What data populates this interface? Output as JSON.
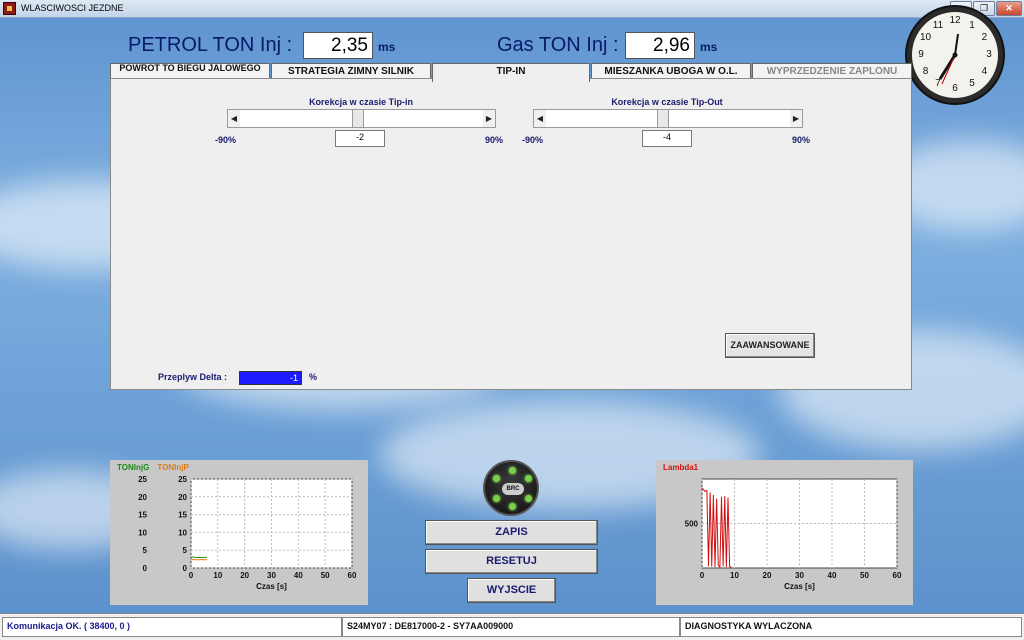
{
  "window": {
    "title": "WLASCIWOSCI JEZDNE",
    "min_glyph": "—",
    "max_glyph": "❐",
    "close_glyph": "✕"
  },
  "header": {
    "petrol_label": "PETROL TON Inj :",
    "petrol_value": "2,35",
    "gas_label": "Gas TON Inj :",
    "gas_value": "2,96",
    "unit": "ms"
  },
  "clock": {
    "numbers": [
      "12",
      "1",
      "2",
      "3",
      "4",
      "5",
      "6",
      "7",
      "8",
      "9",
      "10",
      "11"
    ]
  },
  "tabs": [
    {
      "label": "POWROT TO BIEGU JALOWEGO",
      "active": false
    },
    {
      "label": "STRATEGIA ZIMNY SILNIK",
      "active": false
    },
    {
      "label": "TIP-IN",
      "active": true
    },
    {
      "label": "MIESZANKA UBOGA W O.L.",
      "active": false
    },
    {
      "label": "WYPRZEDZENIE ZAPLONU",
      "active": false,
      "disabled": true
    }
  ],
  "tipin": {
    "title": "Korekcja w czasie Tip-in",
    "min": "-90%",
    "max": "90%",
    "value": "-2"
  },
  "tipout": {
    "title": "Korekcja w czasie Tip-Out",
    "min": "-90%",
    "max": "90%",
    "value": "-4"
  },
  "advanced_button": "ZAAWANSOWANE",
  "flow": {
    "label": "Przeplyw Delta :",
    "value": "-1",
    "unit": "%"
  },
  "buttons": {
    "save": "ZAPIS",
    "reset": "RESETUJ",
    "exit": "WYJSCIE"
  },
  "logo_text": "BRC",
  "status": {
    "comm": "Komunikacja OK. ( 38400,  0 )",
    "ecu": "S24MY07 : DE817000-2 - SY7AA009000",
    "diag": "DIAGNOSTYKA WYLACZONA"
  },
  "chart_data": [
    {
      "type": "line",
      "series": [
        {
          "name": "TONInjG",
          "color": "#1a8c1a",
          "x": [
            0,
            1,
            2,
            3,
            4,
            5,
            6
          ],
          "values": [
            3.0,
            3.1,
            2.9,
            3.0,
            2.9,
            3.0,
            3.0
          ]
        },
        {
          "name": "TONInjP",
          "color": "#e07a10",
          "x": [
            0,
            1,
            2,
            3,
            4,
            5,
            6
          ],
          "values": [
            2.3,
            2.4,
            2.3,
            2.3,
            2.4,
            2.3,
            2.35
          ]
        }
      ],
      "xlabel": "Czas [s]",
      "ylabel": "",
      "xlim": [
        0,
        60
      ],
      "ylim": [
        0,
        25
      ],
      "xticks": [
        0,
        10,
        20,
        30,
        40,
        50,
        60
      ],
      "yticks": [
        0,
        5,
        10,
        15,
        20,
        25
      ],
      "dual_axis": true,
      "grid": true
    },
    {
      "type": "line",
      "series": [
        {
          "name": "Lambda1",
          "color": "#d01010",
          "x": [
            0,
            0.5,
            1,
            1.5,
            2,
            2.5,
            3,
            3.5,
            4,
            4.5,
            5,
            5.5,
            6,
            6.5,
            7,
            7.5,
            8,
            8.5,
            9
          ],
          "values": [
            900,
            880,
            860,
            870,
            20,
            850,
            15,
            820,
            10,
            780,
            30,
            10,
            800,
            20,
            810,
            10,
            790,
            15,
            10
          ]
        }
      ],
      "xlabel": "Czas [s]",
      "ylabel": "",
      "xlim": [
        0,
        60
      ],
      "ylim": [
        0,
        1000
      ],
      "xticks": [
        0,
        10,
        20,
        30,
        40,
        50,
        60
      ],
      "yticks": [
        500
      ],
      "grid": true
    }
  ]
}
